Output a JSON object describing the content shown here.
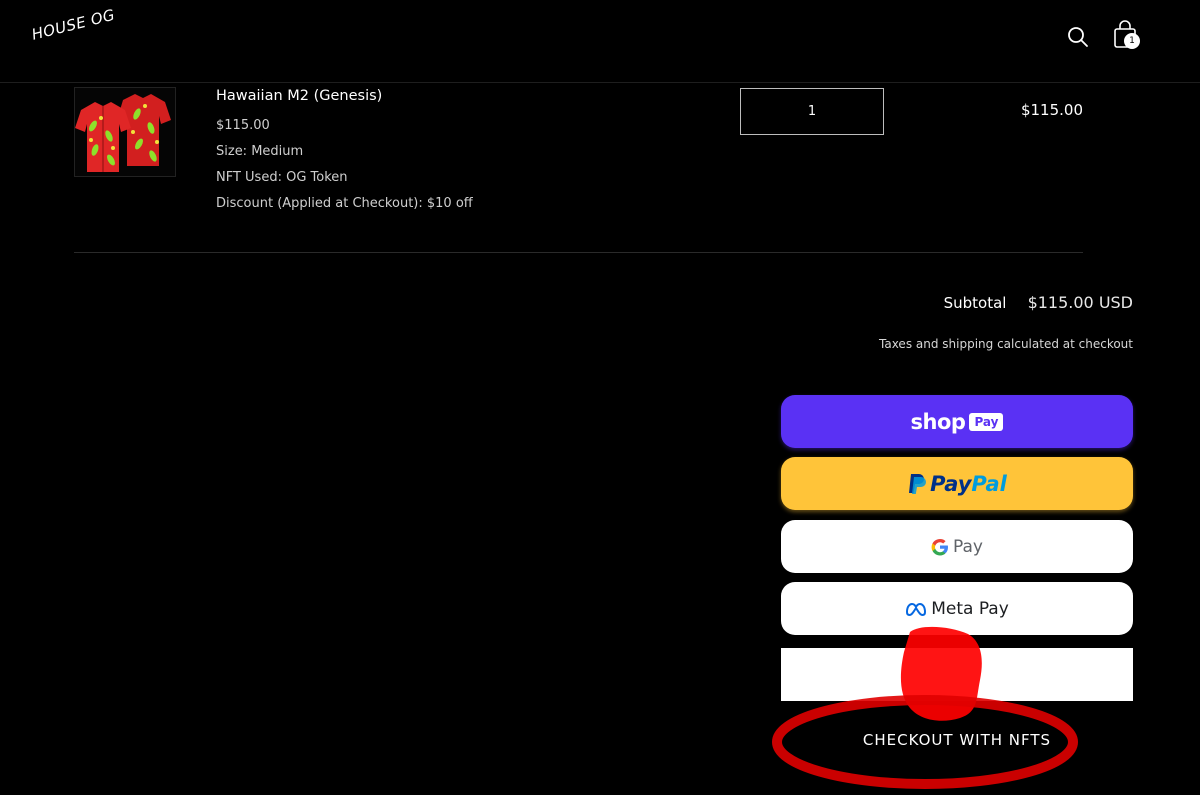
{
  "header": {
    "logo": "HOUSE OG",
    "cart_count": "1"
  },
  "line_item": {
    "title": "Hawaiian M2 (Genesis)",
    "price": "$115.00",
    "size": "Size: Medium",
    "nft": "NFT Used: OG Token",
    "discount": "Discount (Applied at Checkout): $10 off",
    "quantity": "1",
    "line_total": "$115.00"
  },
  "totals": {
    "subtotal_label": "Subtotal",
    "subtotal_value": "$115.00 USD",
    "tax_note": "Taxes and shipping calculated at checkout"
  },
  "payments": {
    "shop_word": "shop",
    "shop_badge": "Pay",
    "paypal_a": "Pay",
    "paypal_b": "Pal",
    "gpay_label": "Pay",
    "metapay_label": "Meta Pay"
  },
  "nft_checkout": {
    "label": "CHECKOUT WITH NFTS"
  },
  "colors": {
    "shop_pay": "#5a31f4",
    "paypal": "#ffc439",
    "annotation_red": "#ff0000"
  },
  "icons": [
    "search-icon",
    "cart-icon",
    "shirt-product-image",
    "google-g-icon",
    "meta-logo-icon"
  ]
}
